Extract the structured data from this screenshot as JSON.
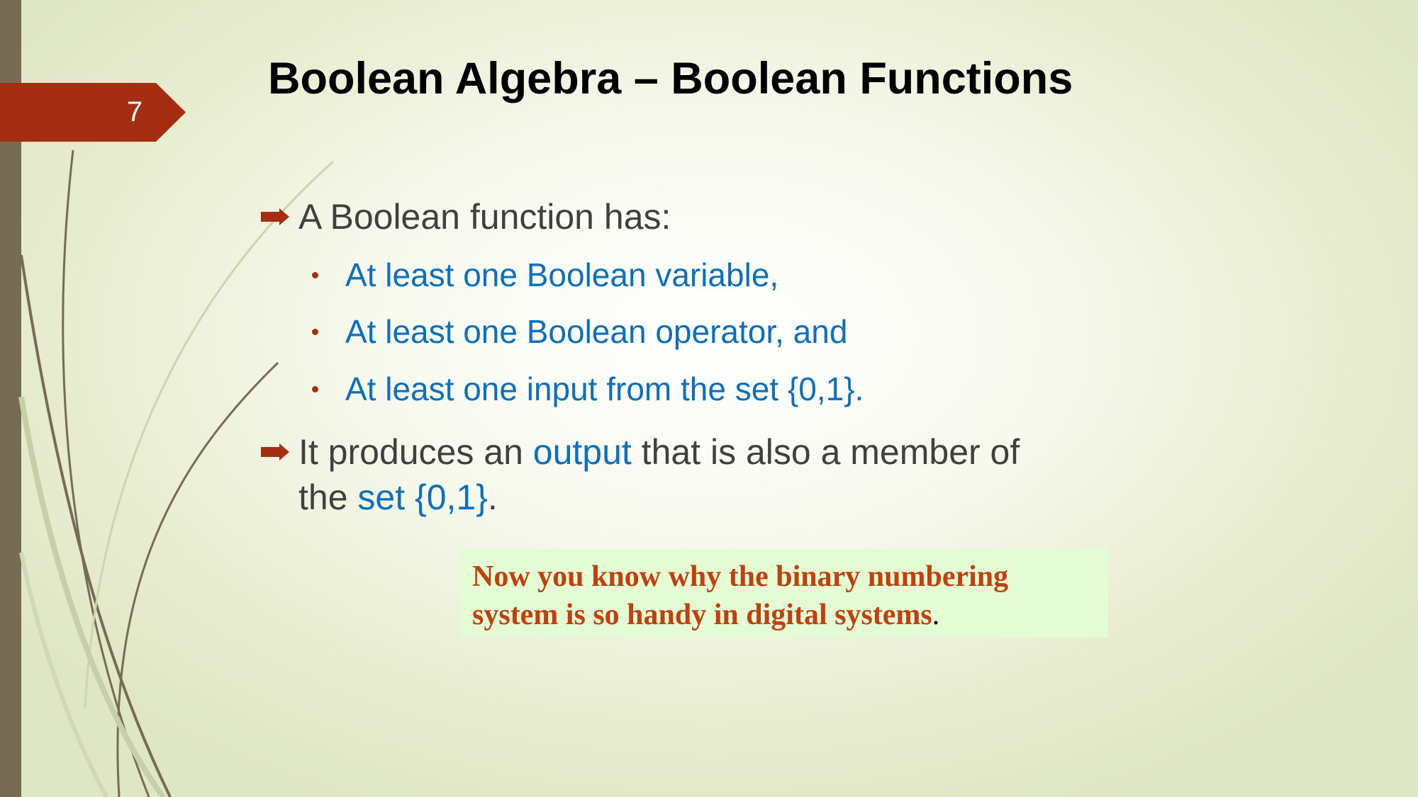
{
  "slide": {
    "number": "7",
    "title": "Boolean Algebra – Boolean Functions"
  },
  "bullets": {
    "b1": {
      "text": "A Boolean function has:"
    },
    "sub1": "At least one Boolean variable,",
    "sub2": "At least one Boolean operator, and",
    "sub3": "At least one input from the set {0,1}.",
    "b2": {
      "part1": "It produces an ",
      "highlight1": "output",
      "part2": " that is also a member of",
      "part3": "the ",
      "highlight2": "set {0,1}",
      "part4": "."
    }
  },
  "note": {
    "line1": "Now you know why the binary numbering",
    "line2": "system is so handy in digital systems",
    "end": "."
  },
  "colors": {
    "accent": "#a52e12",
    "highlight_text": "#0c70be",
    "body_text": "#404040",
    "note_text": "#c0400f",
    "note_background": "#e3fcd3",
    "left_band": "#766c53"
  },
  "icons": {
    "level1_bullet": "arrow-bullet-icon",
    "level2_bullet": "dot-bullet-icon"
  }
}
